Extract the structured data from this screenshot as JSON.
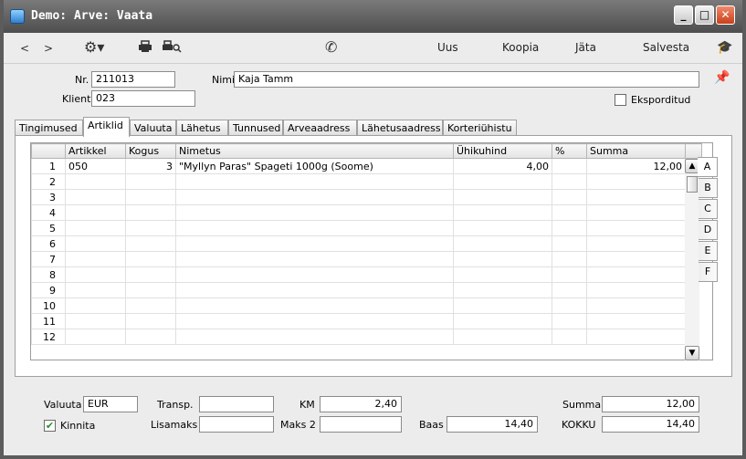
{
  "window": {
    "title": "Demo: Arve: Vaata"
  },
  "toolbar": {
    "uus": "Uus",
    "koopia": "Koopia",
    "jata": "Jäta",
    "salvesta": "Salvesta"
  },
  "header": {
    "nr_label": "Nr.",
    "nr_value": "211013",
    "nimi_label": "Nimi",
    "nimi_value": "Kaja Tamm",
    "klient_label": "Klient",
    "klient_value": "023",
    "eksporditud_label": "Eksporditud"
  },
  "tabs": [
    "Tingimused",
    "Artiklid",
    "Valuuta",
    "Lähetus",
    "Tunnused",
    "Arveaadress",
    "Lähetusaadress",
    "Korteriühistu"
  ],
  "grid": {
    "columns": [
      "Artikkel",
      "Kogus",
      "Nimetus",
      "Ühikuhind",
      "%",
      "Summa"
    ],
    "rows": [
      {
        "n": "1",
        "artikkel": "050",
        "kogus": "3",
        "nimetus": "\"Myllyn Paras\" Spageti 1000g  (Soome)",
        "uhikuhind": "4,00",
        "pct": "",
        "summa": "12,00"
      },
      {
        "n": "2",
        "artikkel": "",
        "kogus": "",
        "nimetus": "",
        "uhikuhind": "",
        "pct": "",
        "summa": ""
      },
      {
        "n": "3",
        "artikkel": "",
        "kogus": "",
        "nimetus": "",
        "uhikuhind": "",
        "pct": "",
        "summa": ""
      },
      {
        "n": "4",
        "artikkel": "",
        "kogus": "",
        "nimetus": "",
        "uhikuhind": "",
        "pct": "",
        "summa": ""
      },
      {
        "n": "5",
        "artikkel": "",
        "kogus": "",
        "nimetus": "",
        "uhikuhind": "",
        "pct": "",
        "summa": ""
      },
      {
        "n": "6",
        "artikkel": "",
        "kogus": "",
        "nimetus": "",
        "uhikuhind": "",
        "pct": "",
        "summa": ""
      },
      {
        "n": "7",
        "artikkel": "",
        "kogus": "",
        "nimetus": "",
        "uhikuhind": "",
        "pct": "",
        "summa": ""
      },
      {
        "n": "8",
        "artikkel": "",
        "kogus": "",
        "nimetus": "",
        "uhikuhind": "",
        "pct": "",
        "summa": ""
      },
      {
        "n": "9",
        "artikkel": "",
        "kogus": "",
        "nimetus": "",
        "uhikuhind": "",
        "pct": "",
        "summa": ""
      },
      {
        "n": "10",
        "artikkel": "",
        "kogus": "",
        "nimetus": "",
        "uhikuhind": "",
        "pct": "",
        "summa": ""
      },
      {
        "n": "11",
        "artikkel": "",
        "kogus": "",
        "nimetus": "",
        "uhikuhind": "",
        "pct": "",
        "summa": ""
      },
      {
        "n": "12",
        "artikkel": "",
        "kogus": "",
        "nimetus": "",
        "uhikuhind": "",
        "pct": "",
        "summa": ""
      }
    ]
  },
  "side_tabs": [
    "A",
    "B",
    "C",
    "D",
    "E",
    "F"
  ],
  "footer": {
    "valuuta_label": "Valuuta",
    "valuuta_value": "EUR",
    "transp_label": "Transp.",
    "transp_value": "",
    "km_label": "KM",
    "km_value": "2,40",
    "summa_label": "Summa",
    "summa_value": "12,00",
    "kinnita_label": "Kinnita",
    "lisamaks_label": "Lisamaks",
    "lisamaks_value": "",
    "maks2_label": "Maks 2",
    "maks2_value": "",
    "baas_label": "Baas",
    "baas_value": "14,40",
    "kokku_label": "KOKKU",
    "kokku_value": "14,40"
  },
  "colors": {
    "titlebar": "#5a5a5a",
    "window_bg": "#ececec",
    "checkmark": "#2a8a2a"
  }
}
